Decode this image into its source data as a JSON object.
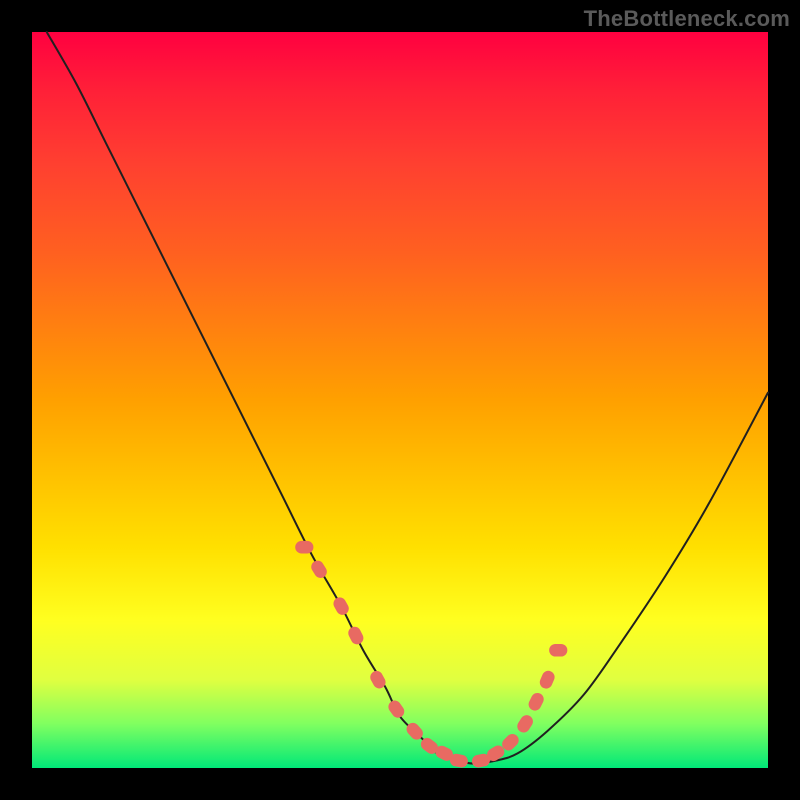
{
  "watermark": "TheBottleneck.com",
  "chart_data": {
    "type": "line",
    "title": "",
    "xlabel": "",
    "ylabel": "",
    "xlim": [
      0,
      100
    ],
    "ylim": [
      0,
      100
    ],
    "grid": false,
    "legend": false,
    "background_gradient": {
      "top": "#ff0040",
      "middle": "#ffd000",
      "bottom": "#00e878"
    },
    "series": [
      {
        "name": "bottleneck-curve",
        "color": "#202020",
        "stroke_width": 2,
        "x": [
          2,
          6,
          10,
          14,
          18,
          22,
          26,
          30,
          34,
          38,
          42,
          45,
          48,
          50,
          53,
          55,
          58,
          60,
          63,
          66,
          70,
          75,
          80,
          86,
          92,
          100
        ],
        "values": [
          100,
          93,
          85,
          77,
          69,
          61,
          53,
          45,
          37,
          29,
          22,
          16,
          11,
          7,
          4,
          2,
          1,
          0.6,
          1,
          2,
          5,
          10,
          17,
          26,
          36,
          51
        ]
      },
      {
        "name": "highlight-markers",
        "type": "scatter",
        "color": "#e86a62",
        "marker_size": 9,
        "x": [
          37,
          39,
          42,
          44,
          47,
          49.5,
          52,
          54,
          56,
          58,
          61,
          63,
          65,
          67,
          68.5,
          70,
          71.5
        ],
        "values": [
          30,
          27,
          22,
          18,
          12,
          8,
          5,
          3,
          2,
          1,
          1,
          2,
          3.5,
          6,
          9,
          12,
          16
        ]
      }
    ]
  }
}
